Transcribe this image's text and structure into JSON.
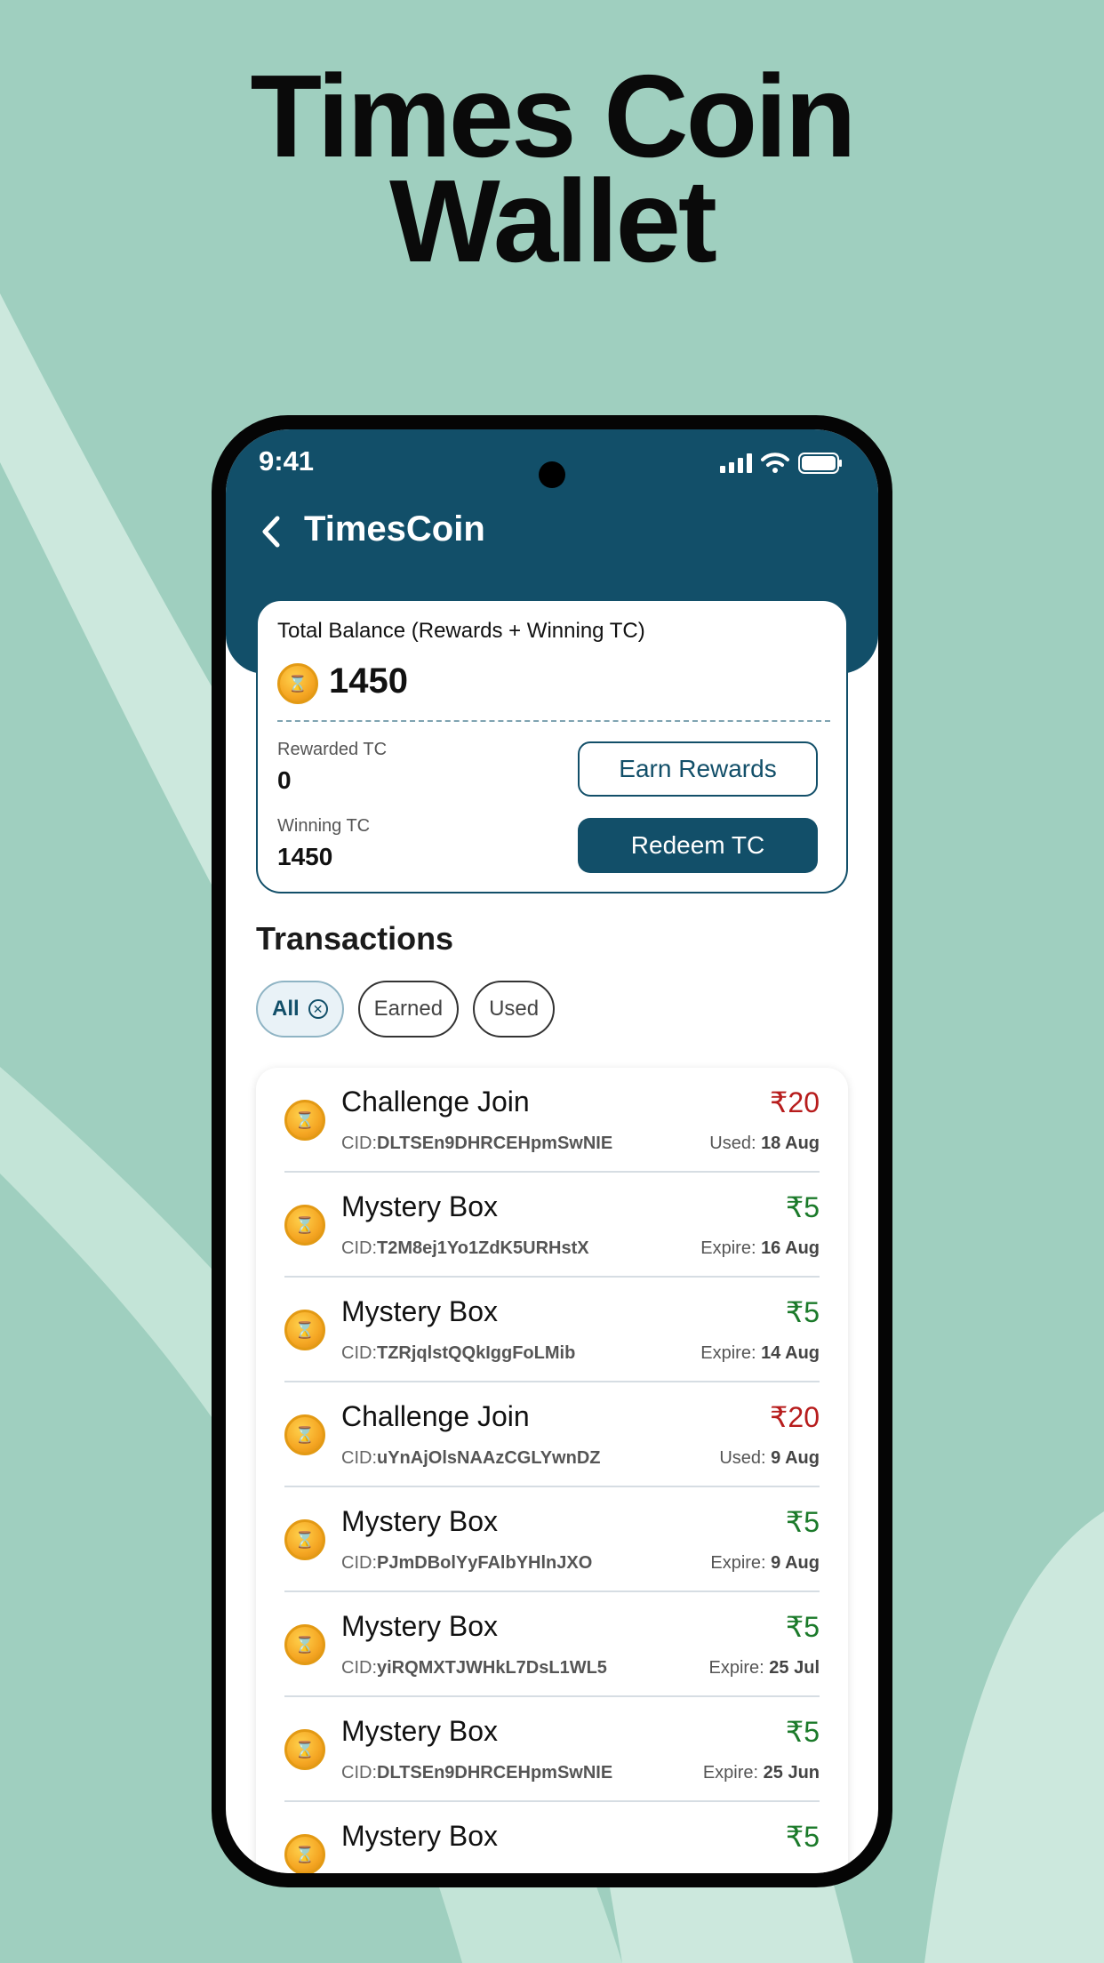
{
  "headline": {
    "line1": "Times Coin",
    "line2": "Wallet"
  },
  "status_bar": {
    "time": "9:41"
  },
  "app_bar": {
    "title": "TimesCoin"
  },
  "balance": {
    "label": "Total Balance (Rewards + Winning TC)",
    "total": "1450",
    "rewarded_label": "Rewarded TC",
    "rewarded_value": "0",
    "winning_label": "Winning TC",
    "winning_value": "1450",
    "earn_button": "Earn Rewards",
    "redeem_button": "Redeem TC"
  },
  "transactions": {
    "title": "Transactions",
    "filters": {
      "all": "All",
      "earned": "Earned",
      "used": "Used"
    },
    "items": [
      {
        "title": "Challenge Join",
        "cid_prefix": "CID:",
        "cid": "DLTSEn9DHRCEHpmSwNIE",
        "amount": "₹20",
        "type": "used",
        "date_label": "Used:",
        "date": "18 Aug"
      },
      {
        "title": "Mystery Box",
        "cid_prefix": "CID:",
        "cid": "T2M8ej1Yo1ZdK5URHstX",
        "amount": "₹5",
        "type": "expire",
        "date_label": "Expire:",
        "date": "16 Aug"
      },
      {
        "title": "Mystery Box",
        "cid_prefix": "CID:",
        "cid": "TZRjqlstQQkIggFoLMib",
        "amount": "₹5",
        "type": "expire",
        "date_label": "Expire:",
        "date": "14 Aug"
      },
      {
        "title": "Challenge Join",
        "cid_prefix": "CID:",
        "cid": "uYnAjOlsNAAzCGLYwnDZ",
        "amount": "₹20",
        "type": "used",
        "date_label": "Used:",
        "date": "9 Aug"
      },
      {
        "title": "Mystery Box",
        "cid_prefix": "CID:",
        "cid": "PJmDBolYyFAlbYHlnJXO",
        "amount": "₹5",
        "type": "expire",
        "date_label": "Expire:",
        "date": "9 Aug"
      },
      {
        "title": "Mystery Box",
        "cid_prefix": "CID:",
        "cid": "yiRQMXTJWHkL7DsL1WL5",
        "amount": "₹5",
        "type": "expire",
        "date_label": "Expire:",
        "date": "25 Jul"
      },
      {
        "title": "Mystery Box",
        "cid_prefix": "CID:",
        "cid": "DLTSEn9DHRCEHpmSwNIE",
        "amount": "₹5",
        "type": "expire",
        "date_label": "Expire:",
        "date": "25 Jun"
      },
      {
        "title": "Mystery Box",
        "cid_prefix": "",
        "cid": "",
        "amount": "₹5",
        "type": "expire",
        "date_label": "",
        "date": ""
      }
    ]
  },
  "colors": {
    "primary": "#124f69",
    "background": "#9fcfbf",
    "used": "#b71c1c",
    "earned": "#1b7a2a"
  }
}
